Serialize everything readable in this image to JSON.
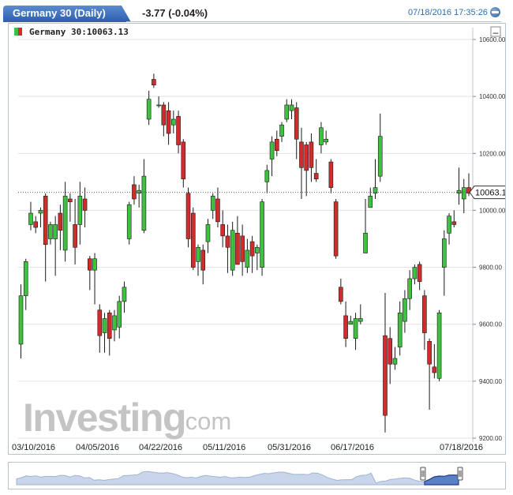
{
  "header": {
    "title": "Germany 30 (Daily)",
    "change": "-3.77 (-0.04%)",
    "datetime": "07/18/2016 17:35:26"
  },
  "legend": {
    "label": "Germany 30:10063.13",
    "minimize": "–"
  },
  "watermark": {
    "brand": "Investing",
    "suffix": ".com"
  },
  "chart_data": {
    "type": "candlestick",
    "instrument": "Germany 30",
    "interval": "Daily",
    "last_price": 10063.13,
    "last_price_label": "10063.13",
    "ylim": [
      9200,
      10600
    ],
    "yticks": [
      "9200.00",
      "9400.00",
      "9600.00",
      "9800.00",
      "10000.00",
      "10200.00",
      "10400.00",
      "10600.00"
    ],
    "xticks": [
      "03/10/2016",
      "04/05/2016",
      "04/22/2016",
      "05/11/2016",
      "05/31/2016",
      "06/17/2016",
      "07/18/2016"
    ],
    "grid": true,
    "colors": {
      "up": "#3ec13e",
      "down": "#d12c2c",
      "grid": "#dde3ea",
      "axis": "#333333"
    },
    "candles": [
      [
        9530,
        9700,
        9480,
        9740
      ],
      [
        9700,
        9820,
        9650,
        9830
      ],
      [
        9950,
        9990,
        9930,
        10030
      ],
      [
        9960,
        9940,
        9920,
        9980
      ],
      [
        9990,
        10000,
        9940,
        10010
      ],
      [
        10050,
        9880,
        9750,
        10060
      ],
      [
        9900,
        9950,
        9880,
        9960
      ],
      [
        9900,
        9950,
        9770,
        9980
      ],
      [
        9990,
        9930,
        9860,
        10020
      ],
      [
        9860,
        10050,
        9820,
        10100
      ],
      [
        10040,
        10030,
        9960,
        10060
      ],
      [
        9950,
        9870,
        9810,
        10040
      ],
      [
        9950,
        10050,
        9880,
        10100
      ],
      [
        10040,
        10000,
        9940,
        10080
      ],
      [
        9830,
        9790,
        9720,
        9840
      ],
      [
        9790,
        9830,
        9670,
        9850
      ],
      [
        9650,
        9560,
        9500,
        9670
      ],
      [
        9570,
        9620,
        9500,
        9640
      ],
      [
        9640,
        9550,
        9490,
        9650
      ],
      [
        9580,
        9630,
        9540,
        9650
      ],
      [
        9590,
        9680,
        9550,
        9700
      ],
      [
        9680,
        9730,
        9640,
        9750
      ],
      [
        9900,
        10020,
        9880,
        10030
      ],
      [
        10090,
        10040,
        10020,
        10120
      ],
      [
        10060,
        10070,
        10010,
        10090
      ],
      [
        9930,
        10120,
        9920,
        10180
      ],
      [
        10320,
        10390,
        10300,
        10420
      ],
      [
        10460,
        10440,
        10430,
        10480
      ],
      [
        10370,
        10370,
        10360,
        10400
      ],
      [
        10370,
        10300,
        10260,
        10380
      ],
      [
        10350,
        10270,
        10230,
        10380
      ],
      [
        10300,
        10320,
        10270,
        10350
      ],
      [
        10330,
        10230,
        10200,
        10350
      ],
      [
        10240,
        10110,
        10080,
        10250
      ],
      [
        10060,
        9900,
        9870,
        10080
      ],
      [
        9990,
        9800,
        9790,
        10010
      ],
      [
        9820,
        9870,
        9770,
        9880
      ],
      [
        9860,
        9790,
        9740,
        9880
      ],
      [
        9890,
        9950,
        9850,
        9970
      ],
      [
        10000,
        10050,
        9970,
        10060
      ],
      [
        10040,
        9960,
        9940,
        10080
      ],
      [
        9950,
        9910,
        9870,
        10000
      ],
      [
        9910,
        9870,
        9780,
        9950
      ],
      [
        9790,
        9930,
        9770,
        9960
      ],
      [
        9920,
        9810,
        9810,
        9980
      ],
      [
        9910,
        9820,
        9770,
        9950
      ],
      [
        9800,
        9860,
        9780,
        9900
      ],
      [
        9890,
        9840,
        9780,
        9910
      ],
      [
        9850,
        9870,
        9790,
        9880
      ],
      [
        9800,
        10030,
        9770,
        10040
      ],
      [
        10100,
        10140,
        10060,
        10160
      ],
      [
        10180,
        10240,
        10120,
        10260
      ],
      [
        10250,
        10210,
        10190,
        10280
      ],
      [
        10260,
        10300,
        10240,
        10310
      ],
      [
        10320,
        10370,
        10310,
        10390
      ],
      [
        10350,
        10370,
        10320,
        10390
      ],
      [
        10360,
        10250,
        10180,
        10380
      ],
      [
        10240,
        10150,
        10040,
        10290
      ],
      [
        10230,
        10140,
        10050,
        10240
      ],
      [
        10240,
        10150,
        10100,
        10270
      ],
      [
        10130,
        10110,
        10100,
        10180
      ],
      [
        10230,
        10290,
        10200,
        10310
      ],
      [
        10240,
        10250,
        10230,
        10280
      ],
      [
        10170,
        10080,
        10060,
        10180
      ],
      [
        10030,
        9840,
        9830,
        10040
      ],
      [
        9730,
        9680,
        9670,
        9760
      ],
      [
        9630,
        9550,
        9520,
        9680
      ],
      [
        9600,
        9610,
        9600,
        9630
      ],
      [
        9550,
        9620,
        9510,
        9640
      ],
      [
        9610,
        9620,
        9600,
        9670
      ],
      [
        9850,
        9920,
        9850,
        10040
      ],
      [
        10010,
        10050,
        10010,
        10080
      ],
      [
        10060,
        10080,
        10040,
        10180
      ],
      [
        10120,
        10260,
        10100,
        10340
      ],
      [
        9560,
        9280,
        9220,
        9710
      ],
      [
        9550,
        9460,
        9390,
        9590
      ],
      [
        9460,
        9480,
        9440,
        9520
      ],
      [
        9520,
        9640,
        9490,
        9680
      ],
      [
        9610,
        9690,
        9570,
        9720
      ],
      [
        9690,
        9760,
        9650,
        9790
      ],
      [
        9760,
        9800,
        9740,
        9810
      ],
      [
        9810,
        9750,
        9720,
        9820
      ],
      [
        9700,
        9570,
        9510,
        9720
      ],
      [
        9540,
        9460,
        9300,
        9550
      ],
      [
        9450,
        9430,
        9410,
        9530
      ],
      [
        9410,
        9640,
        9400,
        9650
      ],
      [
        9800,
        9900,
        9700,
        9930
      ],
      [
        9920,
        9980,
        9880,
        9990
      ],
      [
        9960,
        9950,
        9940,
        10000
      ],
      [
        10060,
        10070,
        10020,
        10150
      ],
      [
        10040,
        10080,
        9990,
        10110
      ],
      [
        10080,
        10060,
        10050,
        10130
      ]
    ]
  },
  "navigator": {
    "label": "date range navigator"
  }
}
